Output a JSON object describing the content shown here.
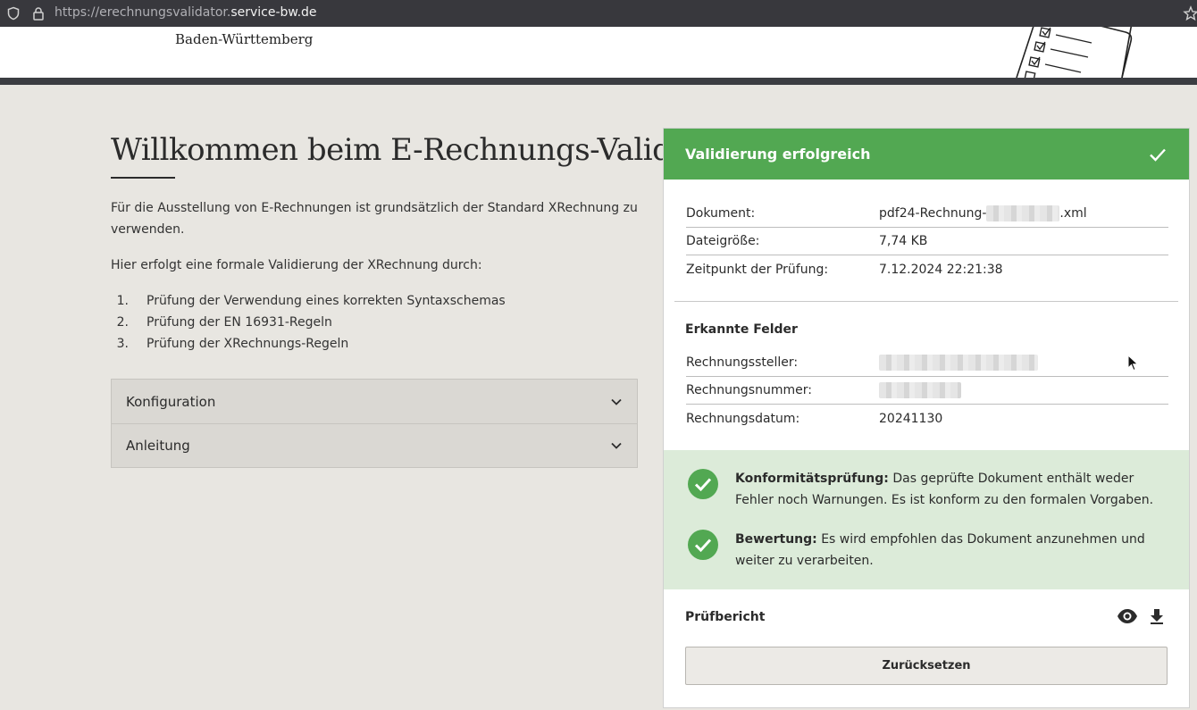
{
  "browser": {
    "url_prefix": "https://erechnungsvalidator.",
    "url_host": "service-bw.de"
  },
  "header": {
    "brand_text": "Baden-Württemberg"
  },
  "main": {
    "title": "Willkommen beim E-Rechnungs-Validator",
    "intro": "Für die Ausstellung von E-Rechnungen ist grundsätzlich der Standard XRechnung zu verwenden.",
    "intro2": "Hier erfolgt eine formale Validierung der XRechnung durch:",
    "steps": [
      {
        "num": "1.",
        "text": "Prüfung der Verwendung eines korrekten Syntaxschemas"
      },
      {
        "num": "2.",
        "text": "Prüfung der EN 16931-Regeln"
      },
      {
        "num": "3.",
        "text": "Prüfung der XRechnungs-Regeln"
      }
    ],
    "accordion": [
      {
        "label": "Konfiguration"
      },
      {
        "label": "Anleitung"
      }
    ]
  },
  "result_card": {
    "header_title": "Validierung erfolgreich",
    "document": {
      "dokument_label": "Dokument:",
      "dokument_prefix": "pdf24-Rechnung-",
      "dokument_suffix": ".xml",
      "dateigroesse_label": "Dateigröße:",
      "dateigroesse_value": "7,74 KB",
      "zeitpunkt_label": "Zeitpunkt der Prüfung:",
      "zeitpunkt_value": "7.12.2024 22:21:38"
    },
    "fields_title": "Erkannte Felder",
    "fields": {
      "rechnungssteller_label": "Rechnungssteller:",
      "rechnungsnummer_label": "Rechnungsnummer:",
      "rechnungsdatum_label": "Rechnungsdatum:",
      "rechnungsdatum_value": "20241130"
    },
    "conformity": {
      "label": "Konformitätsprüfung:",
      "text": " Das geprüfte Dokument enthält weder Fehler noch Warnungen. Es ist konform zu den formalen Vorgaben."
    },
    "assessment": {
      "label": "Bewertung:",
      "text": " Es wird empfohlen das Dokument anzunehmen und weiter zu verarbeiten."
    },
    "report_title": "Prüfbericht",
    "reset_label": "Zurücksetzen"
  },
  "colors": {
    "success_green": "#52a852",
    "result_bg": "#dcebd9",
    "page_bg": "#e8e6e1"
  }
}
